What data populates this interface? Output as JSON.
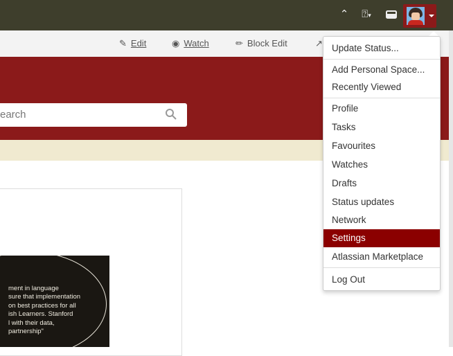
{
  "topbar": {
    "icons": [
      "chevrons-up-icon",
      "help-icon",
      "notifications-icon",
      "user-avatar"
    ]
  },
  "actions": {
    "edit": "Edit",
    "watch": "Watch",
    "block_edit": "Block Edit"
  },
  "search": {
    "placeholder": "earch"
  },
  "photo": {
    "quote": "ment in language\nsure that implementation\non best practices for all\nish Learners. Stanford\nl with their data,\npartnership\""
  },
  "menu": {
    "items": [
      "Update Status...",
      "Add Personal Space...",
      "Recently Viewed",
      "Profile",
      "Tasks",
      "Favourites",
      "Watches",
      "Drafts",
      "Status updates",
      "Network",
      "Settings",
      "Atlassian Marketplace",
      "Log Out"
    ],
    "active": "Settings"
  },
  "colors": {
    "brand": "#8b1a1a",
    "active": "#8b0000",
    "topbar": "#3e3e2c"
  }
}
